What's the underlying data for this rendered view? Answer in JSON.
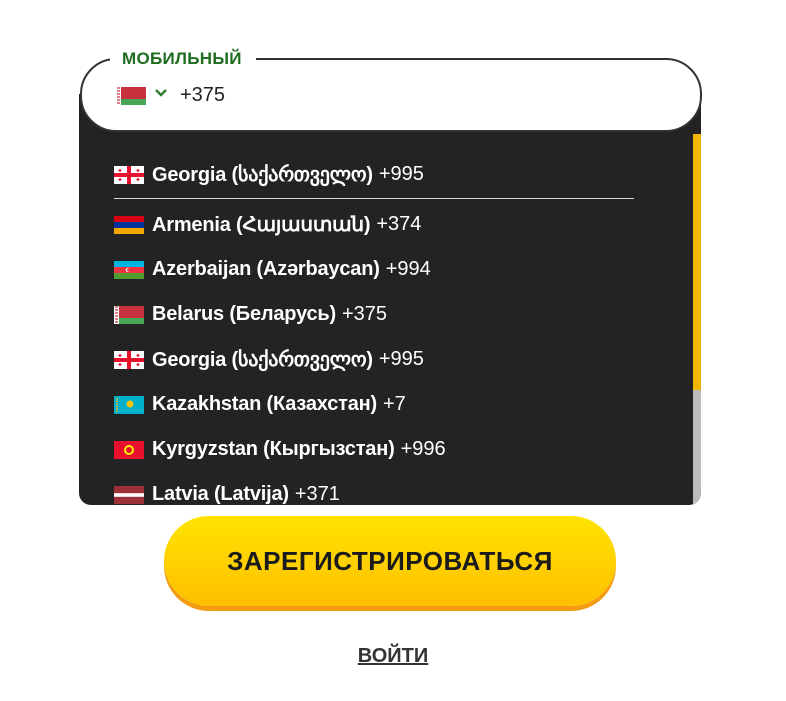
{
  "phone_field": {
    "label": "МОБИЛЬНЫЙ",
    "selected_flag": "flag-belarus",
    "value": "+375"
  },
  "dropdown": {
    "pinned": {
      "name": "Georgia (საქართველო)",
      "code": "+995",
      "flag": "flag-georgia"
    },
    "countries": [
      {
        "name": "Armenia (Հայաստան)",
        "code": "+374",
        "flag": "flag-armenia"
      },
      {
        "name": "Azerbaijan (Azərbaycan)",
        "code": "+994",
        "flag": "flag-azerbaijan"
      },
      {
        "name": "Belarus (Беларусь)",
        "code": "+375",
        "flag": "flag-belarus"
      },
      {
        "name": "Georgia (საქართველო)",
        "code": "+995",
        "flag": "flag-georgia"
      },
      {
        "name": "Kazakhstan (Казахстан)",
        "code": "+7",
        "flag": "flag-kazakhstan"
      },
      {
        "name": "Kyrgyzstan (Кыргызстан)",
        "code": "+996",
        "flag": "flag-kyrgyzstan"
      },
      {
        "name": "Latvia (Latvija)",
        "code": "+371",
        "flag": "flag-latvia"
      }
    ]
  },
  "actions": {
    "register_label": "ЗАРЕГИСТРИРОВАТЬСЯ",
    "login_label": "ВОЙТИ"
  },
  "colors": {
    "accent_yellow": "#ffd200",
    "label_green": "#1f6d1f",
    "dropdown_bg": "#232323"
  }
}
